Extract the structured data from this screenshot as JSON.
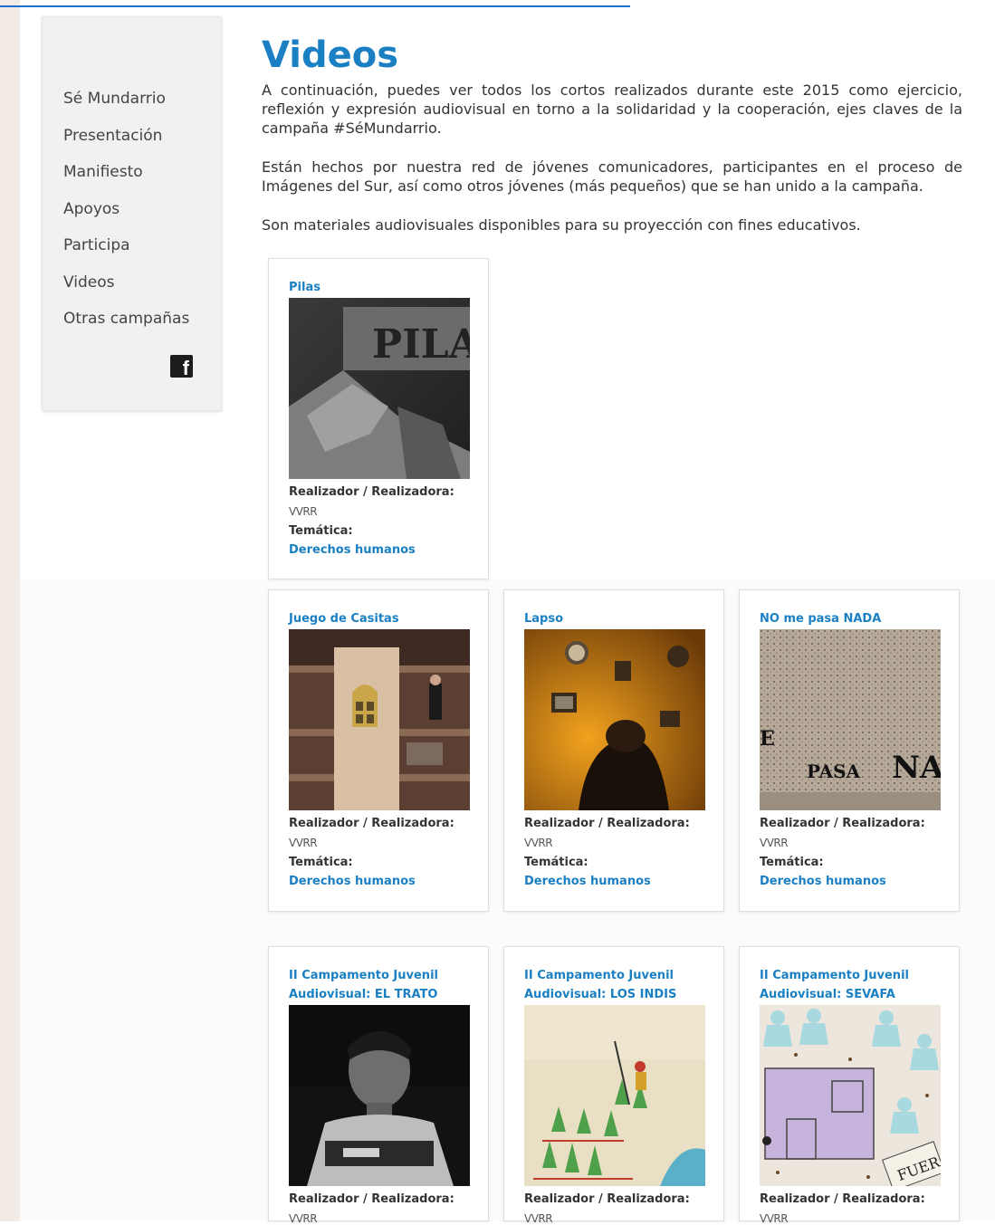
{
  "sidebar": {
    "items": [
      {
        "label": "Sé Mundarrio"
      },
      {
        "label": "Presentación"
      },
      {
        "label": "Manifiesto"
      },
      {
        "label": "Apoyos"
      },
      {
        "label": "Participa"
      },
      {
        "label": "Videos"
      },
      {
        "label": "Otras campañas"
      }
    ],
    "social_icon": "facebook-icon"
  },
  "main": {
    "title": "Videos",
    "paragraphs": [
      "A continuación, puedes ver todos los cortos realizados durante este 2015 como ejercicio, reflexión y expresión audiovisual en torno a la solidaridad y la cooperación, ejes claves de la campaña #SéMundarrio.",
      "Están hechos por nuestra red de jóvenes comunicadores, participantes en el proceso de Imágenes del Sur, así como otros jóvenes (más pequeños) que se han unido a la campaña.",
      "Son materiales audiovisuales disponibles para su proyección con fines educativos."
    ]
  },
  "labels": {
    "realizador": "Realizador / Realizadora:",
    "tematica": "Temática:"
  },
  "videos": [
    {
      "title": "Pilas",
      "thumb_text": "PILA",
      "author": "VVRR",
      "tematica": "Derechos humanos"
    },
    {
      "title": "Juego de Casitas",
      "author": "VVRR",
      "tematica": "Derechos humanos"
    },
    {
      "title": "Lapso",
      "author": "VVRR",
      "tematica": "Derechos humanos"
    },
    {
      "title": "NO me pasa NADA",
      "thumb_text_1": "E",
      "thumb_text_2": "PASA",
      "thumb_text_3": "NA",
      "author": "VVRR",
      "tematica": "Derechos humanos"
    },
    {
      "title": "II Campamento Juvenil Audiovisual: EL TRATO",
      "author": "VVRR"
    },
    {
      "title": "II Campamento Juvenil Audiovisual: LOS INDIS",
      "author": "VVRR"
    },
    {
      "title": "II Campamento Juvenil Audiovisual: SEVAFA",
      "thumb_text": "FUERA",
      "author": "VVRR"
    }
  ],
  "colors": {
    "accent": "#1b80c3",
    "sidebar_bg": "#f1f1f1",
    "link_underline": "#1a6fd0"
  }
}
